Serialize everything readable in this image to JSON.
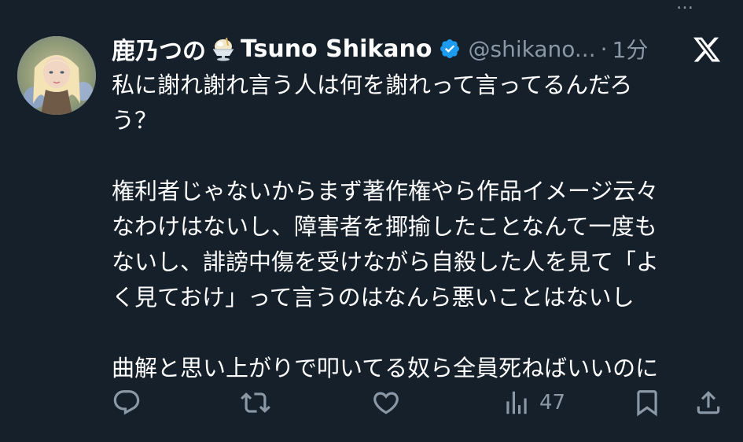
{
  "top_overflow_text": "…",
  "tweet": {
    "display_name": "鹿乃つの",
    "display_name_en": "Tsuno Shikano",
    "emoji_icon": "shaved-ice-emoji",
    "verified_icon": "verified-badge",
    "handle": "@shikano...",
    "separator": "·",
    "time": "1分",
    "platform_icon": "x-logo",
    "body": {
      "line1": "私に謝れ謝れ言う人は何を謝れって言ってるんだろ",
      "line2": "う？",
      "line3": "権利者じゃないからまず著作権やら作品イメージ云々",
      "line4": "なわけはないし、障害者を揶揄したことなんて一度も",
      "line5": "ないし、誹謗中傷を受けながら自殺した人を見て「よ",
      "line6": "く見ておけ」って言うのはなんら悪いことはないし",
      "line7": "曲解と思い上がりで叩いてる奴ら全員死ねばいいのに"
    }
  },
  "actions": {
    "reply_icon": "reply-icon",
    "retweet_icon": "retweet-icon",
    "like_icon": "heart-icon",
    "views_icon": "views-icon",
    "views_count": "47",
    "bookmark_icon": "bookmark-icon",
    "share_icon": "share-icon"
  },
  "colors": {
    "background": "#15202b",
    "text": "#ffffff",
    "muted": "#8b98a5",
    "verified": "#1d9bf0"
  }
}
